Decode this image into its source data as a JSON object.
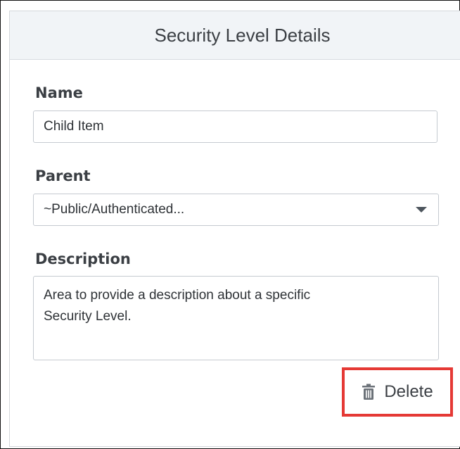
{
  "panel": {
    "title": "Security Level Details"
  },
  "form": {
    "name": {
      "label": "Name",
      "value": "Child Item"
    },
    "parent": {
      "label": "Parent",
      "selected": "~Public/Authenticated..."
    },
    "description": {
      "label": "Description",
      "value": "Area to provide a description about a specific\nSecurity Level."
    }
  },
  "actions": {
    "delete_label": "Delete",
    "delete_icon": "trash-icon",
    "highlight_color": "#e53935"
  }
}
